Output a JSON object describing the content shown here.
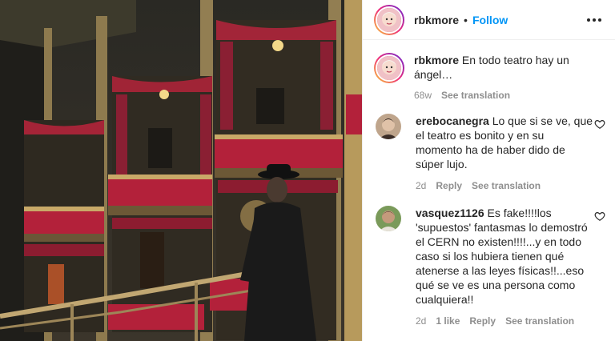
{
  "post": {
    "author": "rbkmore",
    "follow_label": "Follow",
    "separator": "•",
    "caption": "En todo teatro hay un ángel…",
    "caption_time": "68w",
    "see_translation": "See translation"
  },
  "comments": [
    {
      "user": "erebocanegra",
      "text": "Lo que si se ve, que el teatro es bonito y en su momento ha de haber dido de súper lujo.",
      "time": "2d",
      "reply": "Reply",
      "see_translation": "See translation"
    },
    {
      "user": "vasquez1126",
      "text": "Es fake!!!!los 'supuestos' fantasmas lo demostró el CERN no existen!!!!...y en todo caso si los hubiera tienen qué atenerse a las leyes físicas!!...eso qué se ve es una persona como cualquiera!!",
      "time": "2d",
      "likes": "1 like",
      "reply": "Reply",
      "see_translation": "See translation"
    }
  ],
  "colors": {
    "link_blue": "#0095f6",
    "muted": "#8e8e8e",
    "text": "#262626",
    "theatre_red": "#b3213a",
    "gold": "#a58a53"
  },
  "icons": [
    "more-options-icon",
    "heart-icon",
    "heart-icon"
  ]
}
